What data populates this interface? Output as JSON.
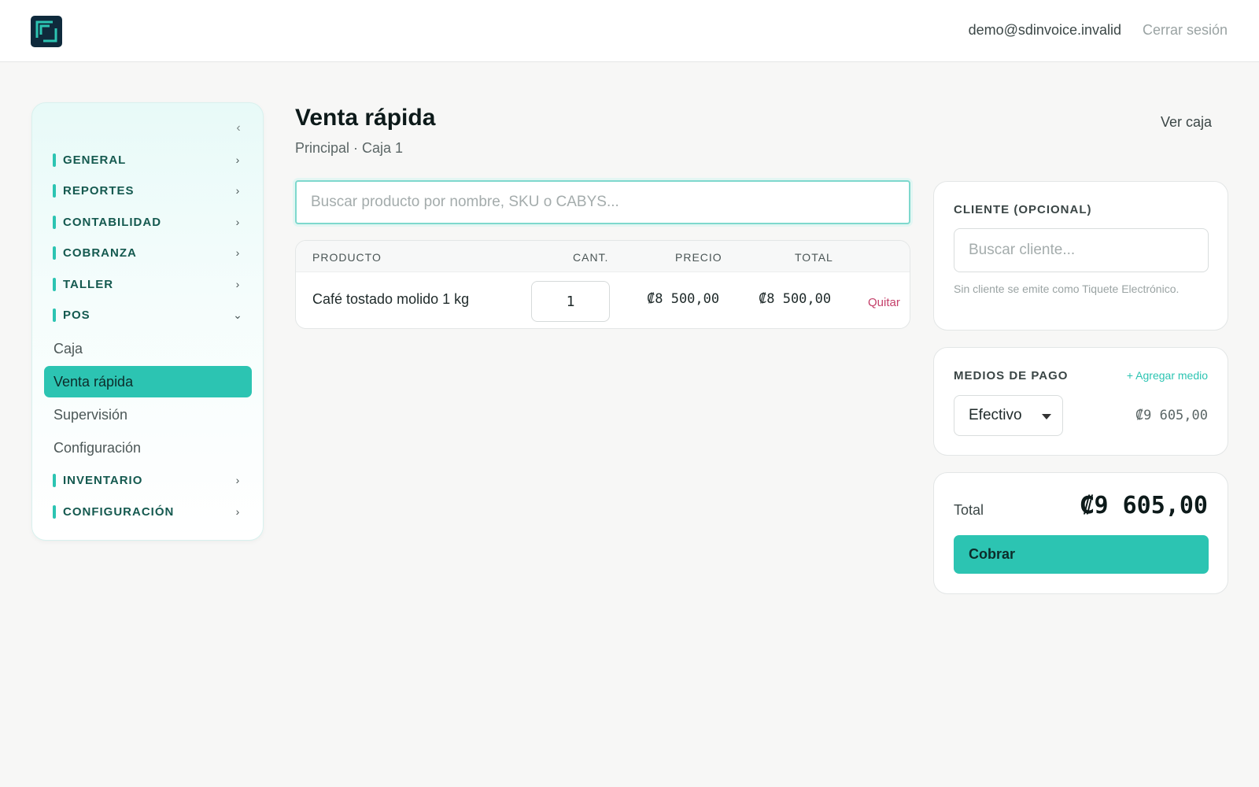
{
  "header": {
    "logo_icon": "sdinvoice-logo-icon",
    "user_email": "demo@sdinvoice.invalid",
    "logout_label": "Cerrar sesión"
  },
  "sidebar": {
    "collapse_icon": "chevron-left-icon",
    "groups": [
      {
        "label": "GENERAL",
        "icon": "chevron-right-icon"
      },
      {
        "label": "REPORTES",
        "icon": "chevron-right-icon"
      },
      {
        "label": "CONTABILIDAD",
        "icon": "chevron-right-icon"
      },
      {
        "label": "COBRANZA",
        "icon": "chevron-right-icon"
      },
      {
        "label": "TALLER",
        "icon": "chevron-right-icon"
      },
      {
        "label": "POS",
        "icon": "chevron-down-icon",
        "expanded": true
      },
      {
        "label": "INVENTARIO",
        "icon": "chevron-right-icon"
      },
      {
        "label": "CONFIGURACIÓN",
        "icon": "chevron-right-icon"
      }
    ],
    "pos_items": [
      {
        "label": "Caja"
      },
      {
        "label": "Venta rápida",
        "active": true
      },
      {
        "label": "Supervisión"
      },
      {
        "label": "Configuración"
      }
    ]
  },
  "main": {
    "title": "Venta rápida",
    "subtitle": "Principal · Caja 1",
    "ver_caja_label": "Ver caja",
    "search_placeholder": "Buscar producto por nombre, SKU o CABYS...",
    "table": {
      "columns": [
        "PRODUCTO",
        "CANT.",
        "PRECIO",
        "TOTAL"
      ],
      "rows": [
        {
          "product": "Café tostado molido 1 kg",
          "qty": "1",
          "price": "₡8 500,00",
          "total": "₡8 500,00",
          "remove_label": "Quitar"
        }
      ]
    }
  },
  "client_card": {
    "title": "CLIENTE (OPCIONAL)",
    "search_placeholder": "Buscar cliente...",
    "hint": "Sin cliente se emite como Tiquete Electrónico."
  },
  "payment_card": {
    "title": "MEDIOS DE PAGO",
    "add_label": "+ Agregar medio",
    "method_selected": "Efectivo",
    "amount": "₡9 605,00"
  },
  "total_card": {
    "label": "Total",
    "amount": "₡9 605,00",
    "charge_label": "Cobrar"
  },
  "colors": {
    "accent": "#2cc4b2",
    "nav_text": "#14594f",
    "danger": "#c4406a",
    "logo_bg": "#0f2a3c"
  }
}
